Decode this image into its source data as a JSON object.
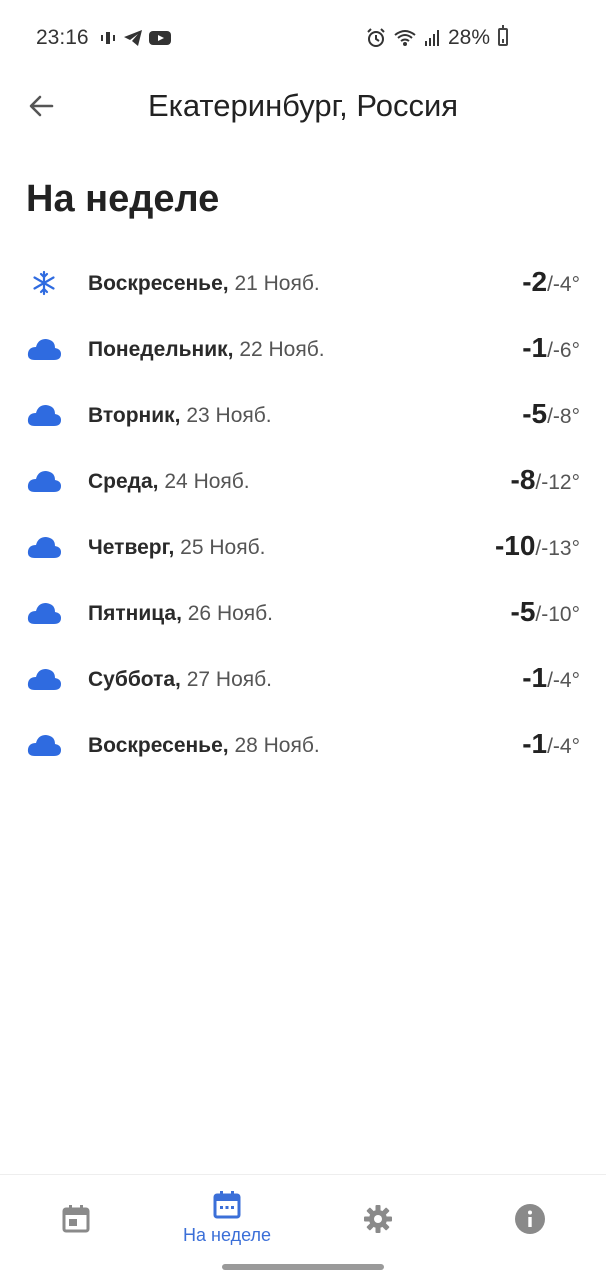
{
  "status_bar": {
    "time": "23:16",
    "battery": "28%",
    "icons": [
      "vibration-icon",
      "telegram-icon",
      "youtube-icon",
      "alarm-icon",
      "wifi-icon",
      "signal-icon",
      "battery-icon"
    ]
  },
  "header": {
    "title": "Екатеринбург, Россия"
  },
  "section": {
    "title": "На неделе"
  },
  "forecast": [
    {
      "icon": "snowflake-icon",
      "day": "Воскресенье,",
      "date": "21 Нояб.",
      "high": "-2",
      "low": "/-4°"
    },
    {
      "icon": "cloud-icon",
      "day": "Понедельник,",
      "date": "22 Нояб.",
      "high": "-1",
      "low": "/-6°"
    },
    {
      "icon": "cloud-icon",
      "day": "Вторник,",
      "date": "23 Нояб.",
      "high": "-5",
      "low": "/-8°"
    },
    {
      "icon": "cloud-icon",
      "day": "Среда,",
      "date": "24 Нояб.",
      "high": "-8",
      "low": "/-12°"
    },
    {
      "icon": "cloud-icon",
      "day": "Четверг,",
      "date": "25 Нояб.",
      "high": "-10",
      "low": "/-13°"
    },
    {
      "icon": "cloud-icon",
      "day": "Пятница,",
      "date": "26 Нояб.",
      "high": "-5",
      "low": "/-10°"
    },
    {
      "icon": "cloud-icon",
      "day": "Суббота,",
      "date": "27 Нояб.",
      "high": "-1",
      "low": "/-4°"
    },
    {
      "icon": "cloud-icon",
      "day": "Воскресенье,",
      "date": "28 Нояб.",
      "high": "-1",
      "low": "/-4°"
    }
  ],
  "bottom_nav": {
    "items": [
      {
        "icon": "calendar-day-icon",
        "label": ""
      },
      {
        "icon": "calendar-week-icon",
        "label": "На неделе"
      },
      {
        "icon": "gear-icon",
        "label": ""
      },
      {
        "icon": "info-icon",
        "label": ""
      }
    ]
  },
  "colors": {
    "accent": "#3b6fd8",
    "cloud": "#2f6be0",
    "inactive_icon": "#8a8a8a"
  }
}
